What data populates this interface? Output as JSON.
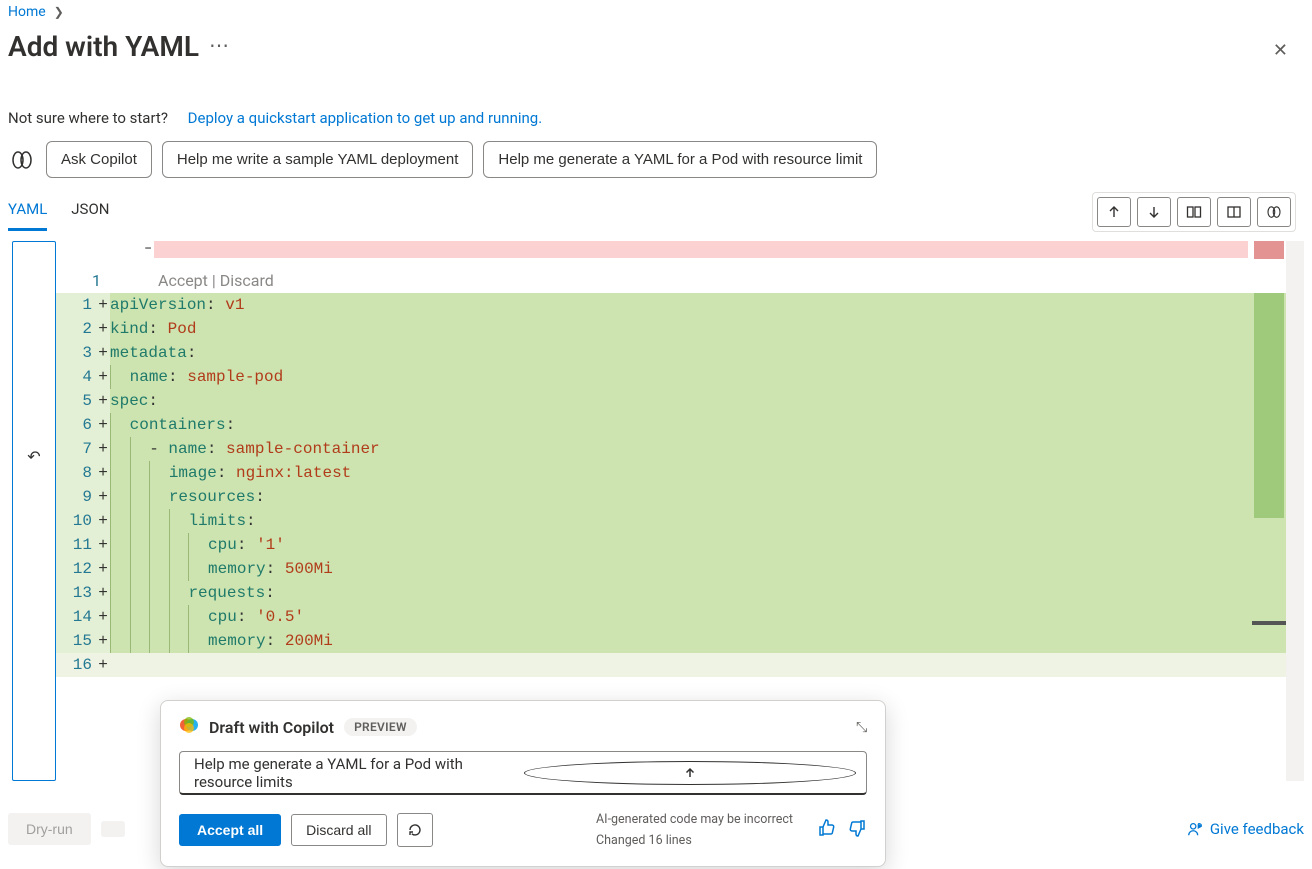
{
  "breadcrumb": {
    "home": "Home"
  },
  "title": "Add with YAML",
  "help_line": {
    "prefix": "Not sure where to start?",
    "link": "Deploy a quickstart application to get up and running."
  },
  "suggestions": {
    "ask_copilot": "Ask Copilot",
    "s1": "Help me write a sample YAML deployment",
    "s2": "Help me generate a YAML for a Pod with resource limit"
  },
  "tabs": {
    "yaml": "YAML",
    "json": "JSON",
    "active": "yaml"
  },
  "inline_actions": {
    "accept": "Accept",
    "sep": "|",
    "discard": "Discard"
  },
  "code_lines": [
    {
      "n": 1,
      "tokens": [
        [
          "key",
          "apiVersion"
        ],
        [
          "punc",
          ": "
        ],
        [
          "str",
          "v1"
        ]
      ]
    },
    {
      "n": 2,
      "tokens": [
        [
          "key",
          "kind"
        ],
        [
          "punc",
          ": "
        ],
        [
          "str",
          "Pod"
        ]
      ]
    },
    {
      "n": 3,
      "tokens": [
        [
          "key",
          "metadata"
        ],
        [
          "punc",
          ":"
        ]
      ]
    },
    {
      "n": 4,
      "indent": 1,
      "tokens": [
        [
          "key",
          "name"
        ],
        [
          "punc",
          ": "
        ],
        [
          "str",
          "sample-pod"
        ]
      ]
    },
    {
      "n": 5,
      "tokens": [
        [
          "key",
          "spec"
        ],
        [
          "punc",
          ":"
        ]
      ]
    },
    {
      "n": 6,
      "indent": 1,
      "tokens": [
        [
          "key",
          "containers"
        ],
        [
          "punc",
          ":"
        ]
      ]
    },
    {
      "n": 7,
      "indent": 2,
      "tokens": [
        [
          "dash",
          "- "
        ],
        [
          "key",
          "name"
        ],
        [
          "punc",
          ": "
        ],
        [
          "str",
          "sample-container"
        ]
      ]
    },
    {
      "n": 8,
      "indent": 3,
      "tokens": [
        [
          "key",
          "image"
        ],
        [
          "punc",
          ": "
        ],
        [
          "str",
          "nginx:latest"
        ]
      ]
    },
    {
      "n": 9,
      "indent": 3,
      "tokens": [
        [
          "key",
          "resources"
        ],
        [
          "punc",
          ":"
        ]
      ]
    },
    {
      "n": 10,
      "indent": 4,
      "tokens": [
        [
          "key",
          "limits"
        ],
        [
          "punc",
          ":"
        ]
      ]
    },
    {
      "n": 11,
      "indent": 5,
      "tokens": [
        [
          "key",
          "cpu"
        ],
        [
          "punc",
          ": "
        ],
        [
          "str",
          "'1'"
        ]
      ]
    },
    {
      "n": 12,
      "indent": 5,
      "tokens": [
        [
          "key",
          "memory"
        ],
        [
          "punc",
          ": "
        ],
        [
          "str",
          "500Mi"
        ]
      ]
    },
    {
      "n": 13,
      "indent": 4,
      "tokens": [
        [
          "key",
          "requests"
        ],
        [
          "punc",
          ":"
        ]
      ]
    },
    {
      "n": 14,
      "indent": 5,
      "tokens": [
        [
          "key",
          "cpu"
        ],
        [
          "punc",
          ": "
        ],
        [
          "str",
          "'0.5'"
        ]
      ]
    },
    {
      "n": 15,
      "indent": 5,
      "tokens": [
        [
          "key",
          "memory"
        ],
        [
          "punc",
          ": "
        ],
        [
          "str",
          "200Mi"
        ]
      ]
    },
    {
      "n": 16,
      "indent": 0,
      "tokens": [],
      "final": true
    }
  ],
  "footer": {
    "dry_run": "Dry-run",
    "give_feedback": "Give feedback"
  },
  "copilot": {
    "title": "Draft with Copilot",
    "badge": "PREVIEW",
    "input": "Help me generate a YAML for a Pod with resource limits",
    "accept_all": "Accept all",
    "discard_all": "Discard all",
    "note1": "AI-generated code may be incorrect",
    "note2": "Changed 16 lines",
    "reloading": false
  }
}
